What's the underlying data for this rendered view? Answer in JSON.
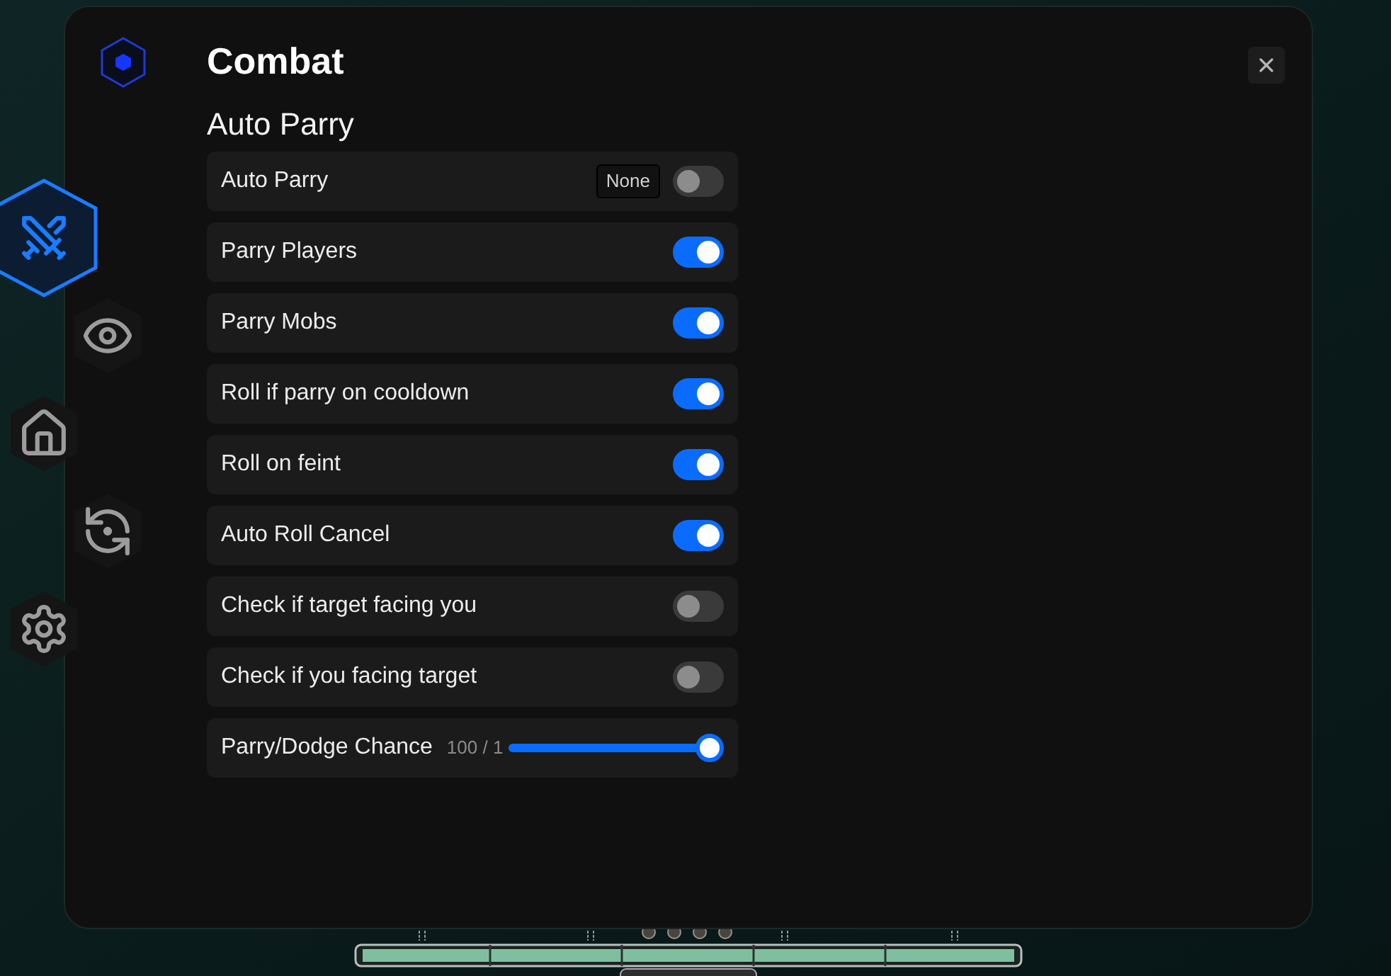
{
  "window": {
    "title": "Combat"
  },
  "nav_tabs": [
    {
      "selected": true
    },
    {
      "selected": false
    },
    {
      "selected": false
    },
    {
      "selected": false
    },
    {
      "selected": false
    }
  ],
  "section": {
    "title": "Auto Parry"
  },
  "settings": [
    {
      "kind": "toggle",
      "label": "Auto Parry",
      "keybind": "None",
      "on": false
    },
    {
      "kind": "toggle",
      "label": "Parry Players",
      "on": true
    },
    {
      "kind": "toggle",
      "label": "Parry Mobs",
      "on": true
    },
    {
      "kind": "toggle",
      "label": "Roll if parry on cooldown",
      "on": true
    },
    {
      "kind": "toggle",
      "label": "Roll on feint",
      "on": true
    },
    {
      "kind": "toggle",
      "label": "Auto Roll Cancel",
      "on": true
    },
    {
      "kind": "toggle",
      "label": "Check if target facing you",
      "on": false
    },
    {
      "kind": "toggle",
      "label": "Check if you facing target",
      "on": false
    },
    {
      "kind": "slider",
      "label": "Parry/Dodge Chance",
      "reading": "100 / 1",
      "level": 1
    }
  ]
}
